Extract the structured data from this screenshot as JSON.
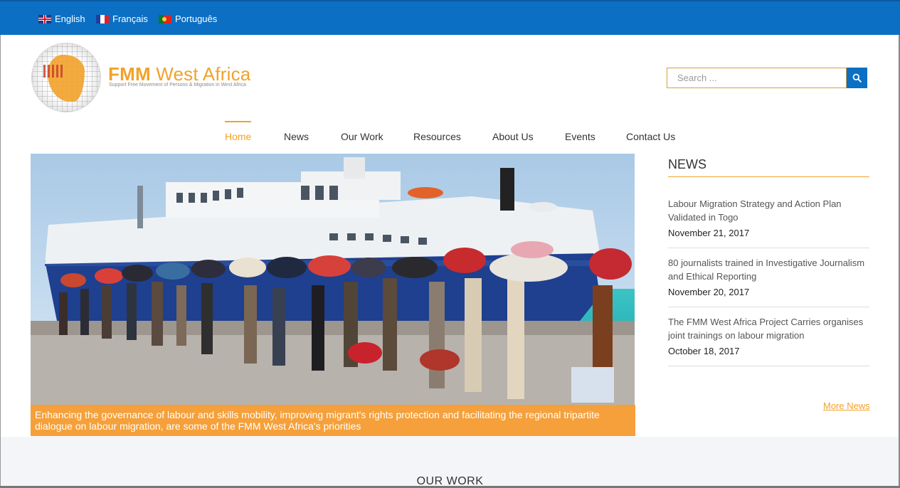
{
  "languages": [
    {
      "label": "English",
      "flag": "uk-flag-icon"
    },
    {
      "label": "Français",
      "flag": "france-flag-icon"
    },
    {
      "label": "Português",
      "flag": "portugal-flag-icon"
    }
  ],
  "brand": {
    "name_bold": "FMM",
    "name_rest": "West Africa",
    "tagline": "Support Free Movement of Persons & Migration in West Africa"
  },
  "search": {
    "placeholder": "Search ...",
    "value": "",
    "icon": "search-icon"
  },
  "nav": {
    "items": [
      "Home",
      "News",
      "Our Work",
      "Resources",
      "About Us",
      "Events",
      "Contact Us"
    ],
    "active": "Home"
  },
  "hero": {
    "caption": "Enhancing the governance of labour and skills mobility, improving migrant's rights protection and facilitating the regional tripartite dialogue on labour migration, are some of the FMM West Africa's priorities"
  },
  "news": {
    "heading": "NEWS",
    "items": [
      {
        "title": "Labour Migration Strategy and Action Plan Validated in Togo",
        "date": "November 21, 2017"
      },
      {
        "title": "80 journalists trained in Investigative Journalism and Ethical Reporting",
        "date": "November 20, 2017"
      },
      {
        "title": "The FMM West Africa Project Carries organises joint trainings on labour migration",
        "date": "October 18, 2017"
      }
    ],
    "more_label": "More News"
  },
  "section": {
    "title": "OUR WORK"
  },
  "colors": {
    "topbar": "#0b6fc4",
    "accent": "#f2a22a",
    "caption_bg": "#f5a03a"
  }
}
